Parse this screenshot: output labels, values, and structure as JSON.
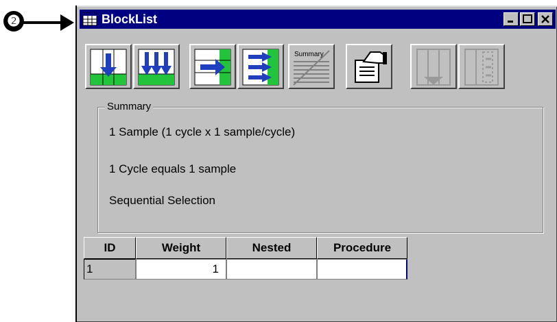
{
  "callout": {
    "number": "❷"
  },
  "window": {
    "title": "BlockList",
    "controls": {
      "minimize": "minimize-icon",
      "maximize": "maximize-icon",
      "close": "close-icon"
    }
  },
  "toolbar": {
    "buttons": [
      {
        "name": "insert-row-icon"
      },
      {
        "name": "insert-multiple-rows-icon"
      },
      {
        "name": "append-column-icon"
      },
      {
        "name": "append-multiple-columns-icon"
      },
      {
        "name": "summary-icon",
        "label": "Summary"
      },
      {
        "name": "properties-icon"
      },
      {
        "name": "disabled-columns-icon"
      },
      {
        "name": "disabled-nested-icon"
      }
    ]
  },
  "summary": {
    "legend": "Summary",
    "lines": [
      "1 Sample (1 cycle x 1 sample/cycle)",
      "1 Cycle equals 1 sample",
      "Sequential Selection"
    ]
  },
  "grid": {
    "headers": [
      "ID",
      "Weight",
      "Nested",
      "Procedure"
    ],
    "rows": [
      {
        "id": "1",
        "weight": "1",
        "nested": "",
        "procedure": ""
      }
    ]
  },
  "colors": {
    "titlebar": "#000080",
    "face": "#c0c0c0",
    "accent_blue": "#1f3fbf",
    "accent_green": "#21c43a"
  }
}
